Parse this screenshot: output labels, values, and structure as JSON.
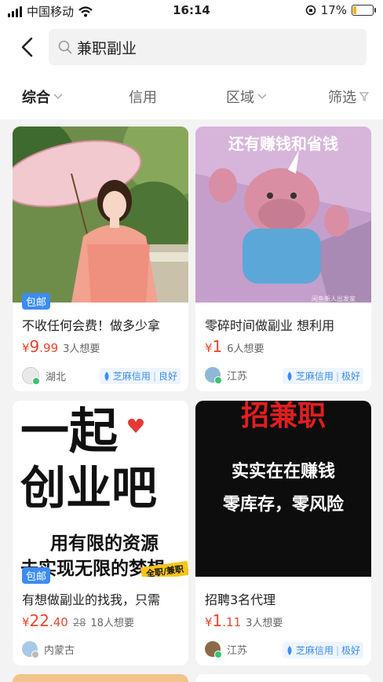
{
  "status": {
    "carrier": "中国移动",
    "time": "16:14",
    "battery": "17%",
    "battery_level": 0.17
  },
  "search": {
    "query": "兼职副业"
  },
  "tabs": [
    {
      "label": "综合"
    },
    {
      "label": "信用"
    },
    {
      "label": "区域"
    },
    {
      "label": "筛选"
    }
  ],
  "cards": [
    {
      "badge": "包邮",
      "title": "不收任何会费！做多少拿",
      "currency": "¥",
      "price_int": "9",
      "price_dec": ".99",
      "want": "3人想要",
      "region": "湖北",
      "credit_label": "芝麻信用",
      "credit_level": "良好"
    },
    {
      "image_text": "还有赚钱和省钱",
      "image_watermark": "闲鱼新人出发家",
      "title": "零碎时间做副业 想利用",
      "currency": "¥",
      "price_int": "1",
      "price_dec": "",
      "want": "6人想要",
      "region": "江苏",
      "credit_label": "芝麻信用",
      "credit_level": "极好"
    },
    {
      "badge": "包邮",
      "image_lines": [
        "一起",
        "创业吧",
        "用有限的资源",
        "去实现无限的梦想"
      ],
      "image_sticker": "全职/兼职",
      "title": "有想做副业的找我，只需",
      "currency": "¥",
      "price_int": "22",
      "price_dec": ".40",
      "price_orig": "28",
      "want": "18人想要",
      "region": "内蒙古"
    },
    {
      "image_lines": [
        "招兼职",
        "实实在在赚钱",
        "零库存，零风险"
      ],
      "title": "招聘3名代理",
      "currency": "¥",
      "price_int": "1",
      "price_dec": ".11",
      "want": "3人想要",
      "region": "江苏",
      "credit_label": "芝麻信用",
      "credit_level": "极好"
    }
  ],
  "colors": {
    "price": "#e8452c",
    "accent_blue": "#3b8cf5",
    "card_bg": "#ffffff",
    "page_bg": "#f3f3f3"
  }
}
